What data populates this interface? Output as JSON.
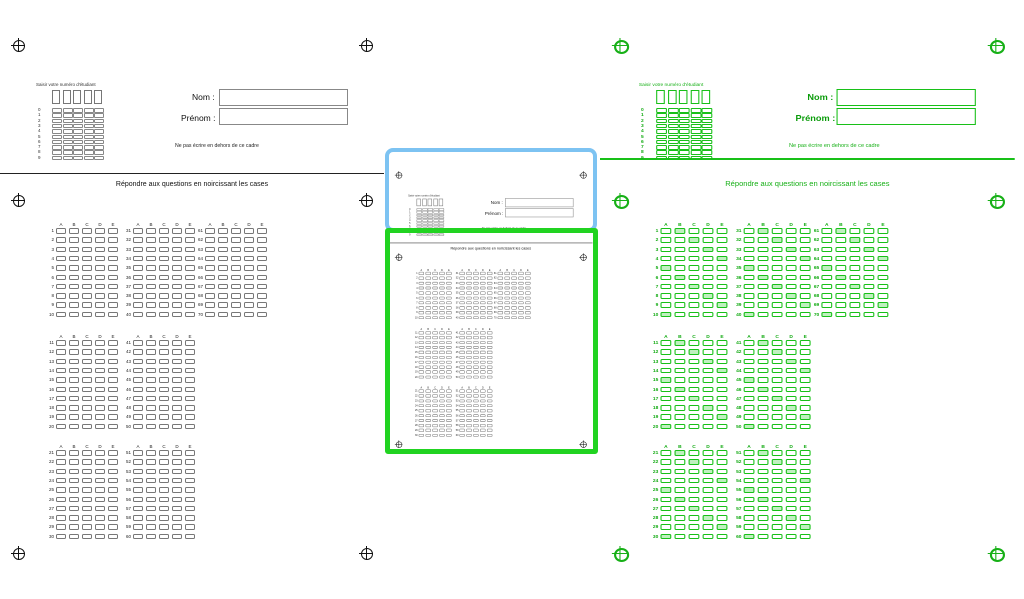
{
  "sheet": {
    "student_id_title": "Saisir votre numéro d'étudiant",
    "nom_label": "Nom :",
    "prenom_label": "Prénom :",
    "warning": "Ne pas écrire en dehors de ce cadre",
    "instruction": "Répondre aux questions en noircissant les cases",
    "answer_letters": [
      "A",
      "B",
      "C",
      "D",
      "E"
    ],
    "id_digits": [
      "0",
      "1",
      "2",
      "3",
      "4",
      "5",
      "6",
      "7",
      "8",
      "9"
    ],
    "question_blocks": [
      {
        "start": 1,
        "end": 10
      },
      {
        "start": 31,
        "end": 40
      },
      {
        "start": 61,
        "end": 70
      },
      {
        "start": 11,
        "end": 20
      },
      {
        "start": 41,
        "end": 50
      },
      {
        "start": 21,
        "end": 30
      },
      {
        "start": 51,
        "end": 60
      }
    ]
  },
  "colors": {
    "blue_frame": "#7dc3f2",
    "green_frame": "#21d321",
    "detection_green": "#18c018"
  },
  "views": [
    {
      "name": "original-scan"
    },
    {
      "name": "detected-regions-thumbnail"
    },
    {
      "name": "detection-overlay"
    }
  ]
}
